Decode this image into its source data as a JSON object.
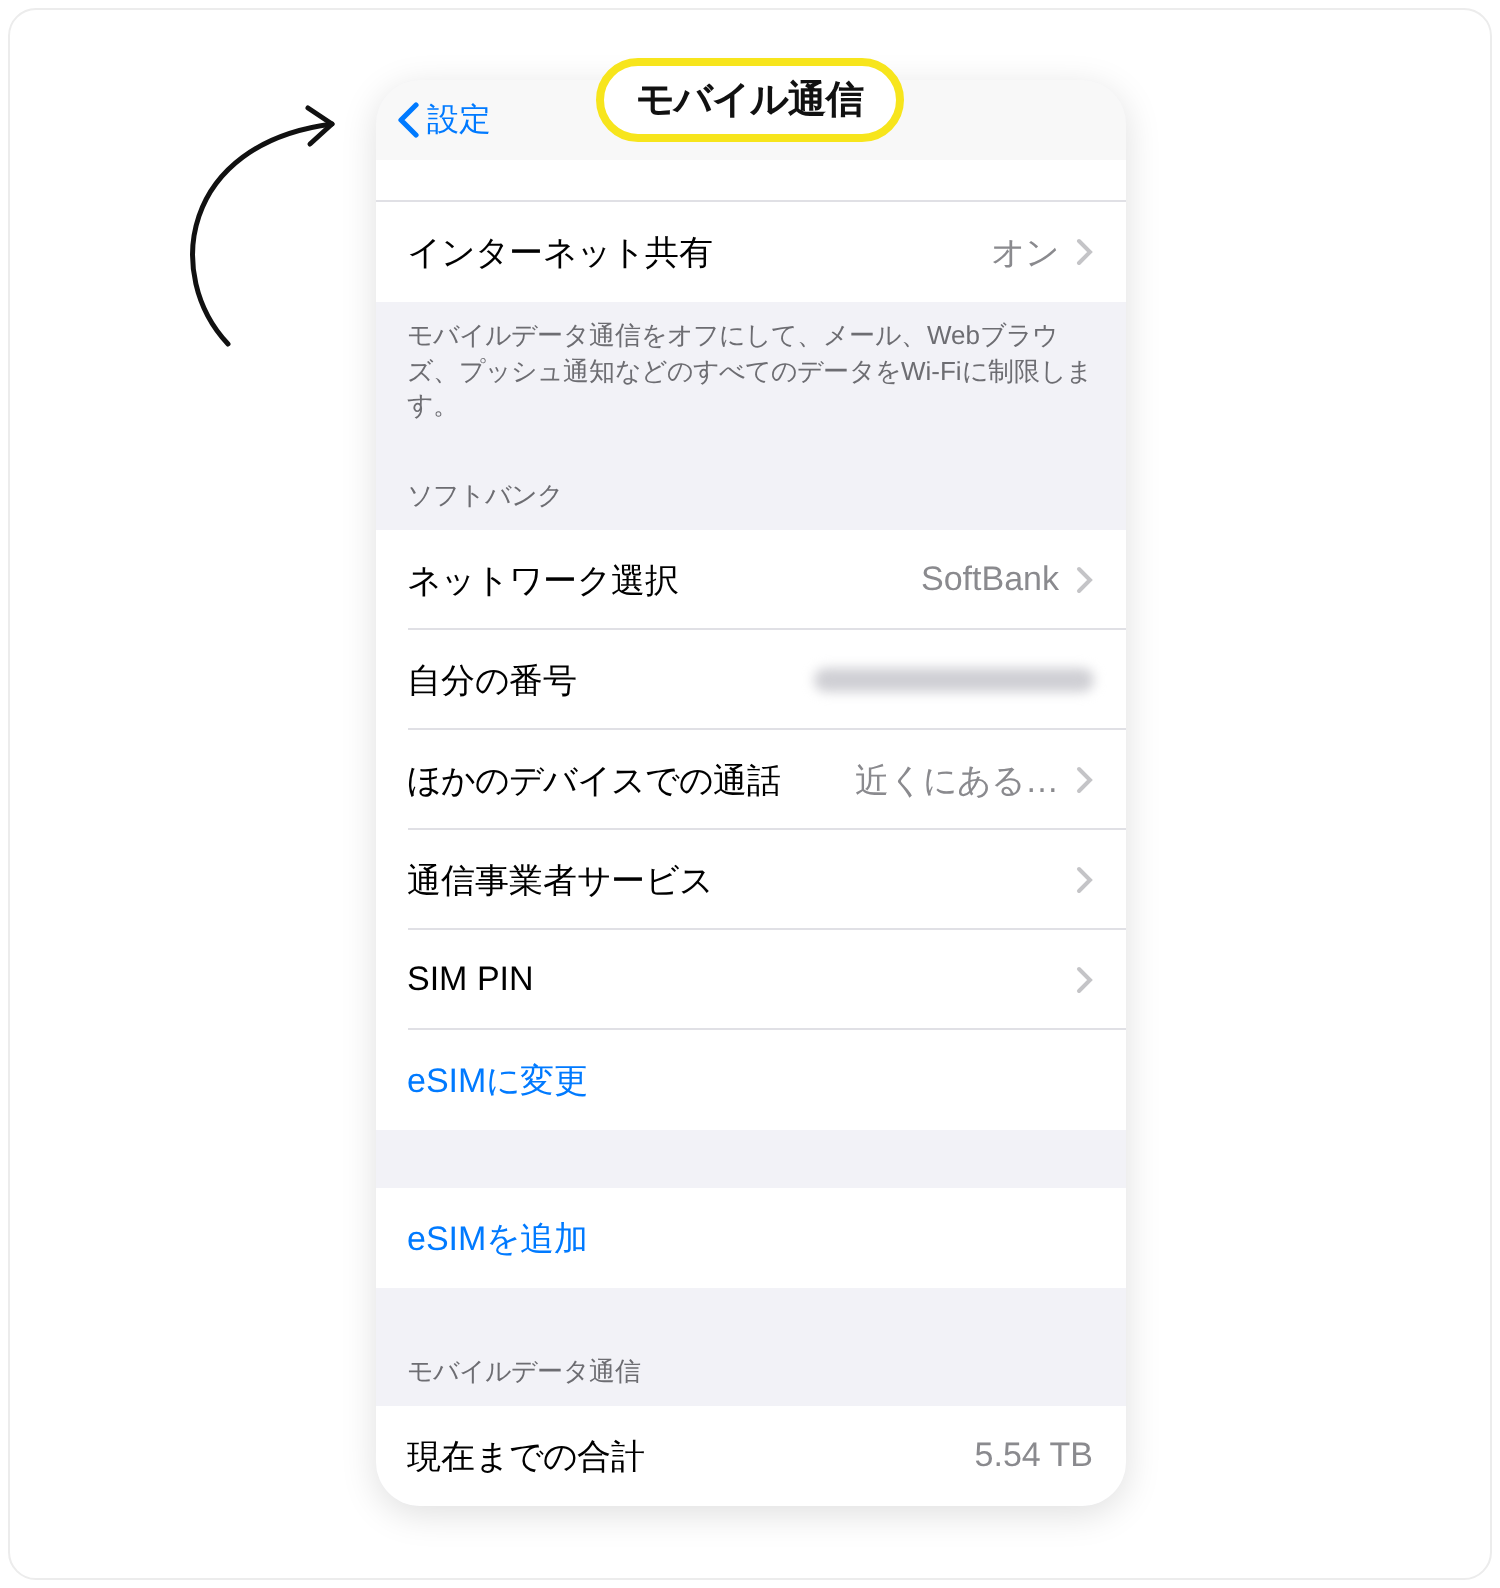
{
  "nav": {
    "back_label": "設定",
    "title": "モバイル通信"
  },
  "sections": [
    {
      "cut_top": true,
      "rows": [
        {
          "kind": "detail",
          "label": "インターネット共有",
          "value": "オン",
          "chevron": true
        }
      ],
      "footer": "モバイルデータ通信をオフにして、メール、Webブラウズ、プッシュ通知などのすべてのデータをWi-Fiに制限します。"
    },
    {
      "header": "ソフトバンク",
      "rows": [
        {
          "kind": "detail",
          "label": "ネットワーク選択",
          "value": "SoftBank",
          "chevron": true
        },
        {
          "kind": "blurred",
          "label": "自分の番号",
          "chevron": false
        },
        {
          "kind": "detail",
          "label": "ほかのデバイスでの通話",
          "value": "近くにある…",
          "chevron": true
        },
        {
          "kind": "detail",
          "label": "通信事業者サービス",
          "chevron": true
        },
        {
          "kind": "detail",
          "label": "SIM PIN",
          "chevron": true
        },
        {
          "kind": "action",
          "label": "eSIMに変更",
          "chevron": false
        }
      ]
    },
    {
      "rows": [
        {
          "kind": "action",
          "label": "eSIMを追加",
          "chevron": false
        }
      ]
    },
    {
      "header": "モバイルデータ通信",
      "rows": [
        {
          "kind": "detail",
          "label": "現在までの合計",
          "value": "5.54 TB",
          "chevron": false
        }
      ]
    }
  ]
}
